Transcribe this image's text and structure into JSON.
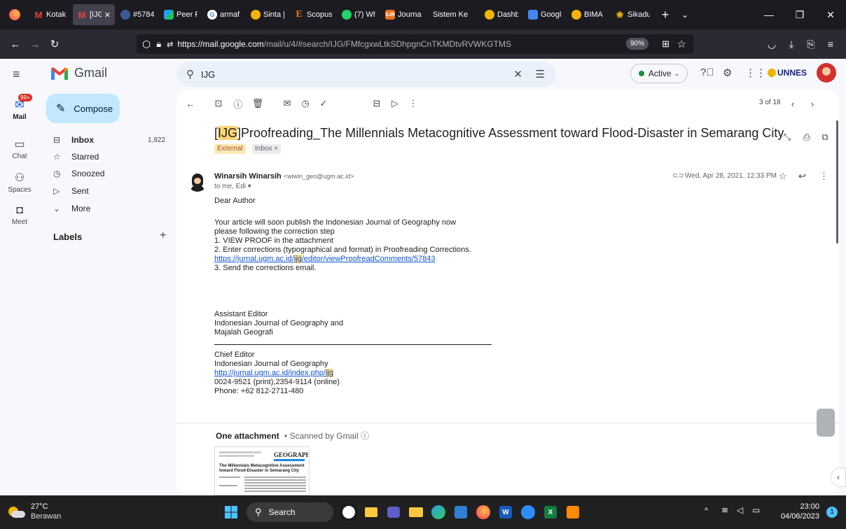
{
  "browser": {
    "tabs": [
      {
        "label": "",
        "icon": "firefox-icon",
        "color": "#ff7139"
      },
      {
        "label": "Kotak",
        "icon": "gmail-icon",
        "color": "#ea4335"
      },
      {
        "label": "[IJG]",
        "icon": "gmail-icon",
        "color": "#ea4335",
        "active": true
      },
      {
        "label": "#5784",
        "icon": "ojs-icon",
        "color": "#3b5998"
      },
      {
        "label": "Peer R",
        "icon": "peer-icon",
        "color": "#ffffff"
      },
      {
        "label": "armaf",
        "icon": "google-icon",
        "color": "#4285f4"
      },
      {
        "label": "Sinta |",
        "icon": "sinta-icon",
        "color": "#8ab4f8"
      },
      {
        "label": "Scopus",
        "icon": "scopus-icon",
        "color": "#e9711c"
      },
      {
        "label": "(7) Wh",
        "icon": "whatsapp-icon",
        "color": "#25d366"
      },
      {
        "label": "Journa",
        "icon": "journal-icon",
        "color": "#e9711c"
      },
      {
        "label": "Sistem Ke",
        "icon": "generic-icon",
        "color": "#1c1b22"
      },
      {
        "label": "Dashb",
        "icon": "dash-icon",
        "color": "#8ab4f8"
      },
      {
        "label": "Google",
        "icon": "google-docs-icon",
        "color": "#4285f4"
      },
      {
        "label": "BIMA |",
        "icon": "bima-icon",
        "color": "#8ab4f8"
      },
      {
        "label": "Sikadu",
        "icon": "sikadu-icon",
        "color": "#fbbc04"
      }
    ],
    "new_tab": "+",
    "url_host": "https://mail.google.com",
    "url_path": "/mail/u/4/#search/IJG/FMfcgxwLtkSDhpgnCnTKMDtvRVWKGTMS",
    "zoom": "90%"
  },
  "gmail": {
    "brand": "Gmail",
    "search_value": "IJG",
    "status": "Active",
    "org_badge": "UNNES",
    "rail": [
      {
        "label": "Mail",
        "badge": "99+"
      },
      {
        "label": "Chat"
      },
      {
        "label": "Spaces"
      },
      {
        "label": "Meet"
      }
    ],
    "compose_label": "Compose",
    "nav": [
      {
        "label": "Inbox",
        "count": "1,922"
      },
      {
        "label": "Starred",
        "count": ""
      },
      {
        "label": "Snoozed",
        "count": ""
      },
      {
        "label": "Sent",
        "count": ""
      },
      {
        "label": "More",
        "count": ""
      }
    ],
    "labels_heading": "Labels",
    "labels_add": "+"
  },
  "message": {
    "position": "3 of 18",
    "subject_tag": "IJG",
    "subject_before": "[",
    "subject_after": "]Proofreading_The Millennials Metacognitive Assessment toward Flood-Disaster in Semarang City",
    "chip_external": "External",
    "chip_inbox": "Inbox ×",
    "sender_name": "Winarsih Winarsih",
    "sender_email": "<wiwin_geo@ugm.ac.id>",
    "to_line": "to me, Edi ▾",
    "date": "Wed, Apr 28, 2021, 12:33 PM",
    "body": {
      "greeting": "Dear Author",
      "l1": "Your article will soon publish the Indonesian Journal of Geography now",
      "l2": "please  following the correction step",
      "l3": "1. VIEW PROOF in the attachment",
      "l4": "2. Enter corrections (typographical and format) in Proofreading Corrections.",
      "link1_pre": "https://jurnal.ugm.ac.id/",
      "link1_hl": "ijg",
      "link1_post": "/editor/viewProofreadComments/57843",
      "l5": "3. Send the corrections email.",
      "sig1": "Assistant Editor",
      "sig2": "Indonesian Journal of Geography and",
      "sig3": "Majalah Geografi",
      "sig4": "Chief Editor",
      "sig5": "Indonesian Journal of Geography",
      "link2_pre": "http://jurnal.ugm.ac.id/index.php/",
      "link2_hl": "ijg",
      "sig6": "0024-9521 (print),2354-9114 (online)",
      "sig7": "Phone: +62 812-2711-480"
    },
    "attachment_heading": "One attachment",
    "attachment_scan": "•  Scanned by Gmail ⓘ",
    "thumb_logo": "GEOGRAPHY",
    "thumb_title": "The Millennials Metacognitive Assessment toward Flood-Disaster in Semarang City"
  },
  "taskbar": {
    "weather_temp": "27°C",
    "weather_text": "Berawan",
    "search_label": "Search",
    "time": "23:00",
    "date": "04/06/2023",
    "apps": [
      {
        "icon": "start-icon",
        "color": "#4cc2ff"
      },
      {
        "icon": "file-explorer-icon",
        "color": "#fcd35b"
      },
      {
        "icon": "teams-icon",
        "color": "#5b5fc7"
      },
      {
        "icon": "camera-icon",
        "color": "#3a8ee6"
      },
      {
        "icon": "folder-icon",
        "color": "#f9c843"
      },
      {
        "icon": "edge-icon",
        "color": "#2c9fe6"
      },
      {
        "icon": "store-icon",
        "color": "#2f7fd5"
      },
      {
        "icon": "firefox-icon",
        "color": "#ff7139"
      },
      {
        "icon": "word-icon",
        "color": "#185abd"
      },
      {
        "icon": "zoom-icon",
        "color": "#2d8cff"
      },
      {
        "icon": "excel-icon",
        "color": "#107c41"
      },
      {
        "icon": "app-icon",
        "color": "#ff8a00"
      }
    ]
  }
}
